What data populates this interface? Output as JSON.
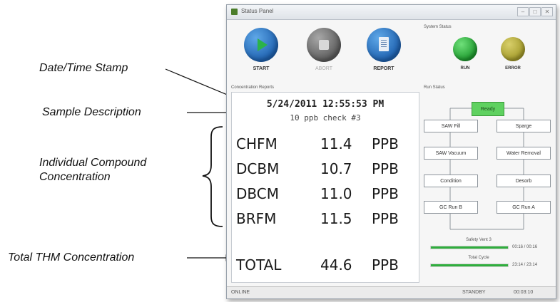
{
  "annotations": {
    "datetime": "Date/Time Stamp",
    "sample": "Sample Description",
    "compound": "Individual Compound Concentration",
    "total": "Total THM Concentration"
  },
  "window": {
    "title": "Status Panel",
    "controls": [
      "–",
      "□",
      "✕"
    ]
  },
  "actions": {
    "start": "START",
    "abort": "ABORT",
    "report": "REPORT"
  },
  "concentration_reports": {
    "label": "Concentration Reports",
    "datetime": "5/24/2011 12:55:53 PM",
    "sample": "10 ppb check #3",
    "compounds": [
      {
        "name": "CHFM",
        "value": "11.4",
        "unit": "PPB"
      },
      {
        "name": "DCBM",
        "value": "10.7",
        "unit": "PPB"
      },
      {
        "name": "DBCM",
        "value": "11.0",
        "unit": "PPB"
      },
      {
        "name": "BRFM",
        "value": "11.5",
        "unit": "PPB"
      }
    ],
    "total": {
      "name": "TOTAL",
      "value": "44.6",
      "unit": "PPB"
    }
  },
  "system_status": {
    "label": "System Status",
    "run": {
      "label": "RUN",
      "color": "#1e9a2e"
    },
    "error": {
      "label": "ERROR",
      "color": "#a39a2a"
    }
  },
  "run_status": {
    "label": "Run Status",
    "ready": "Ready",
    "steps_left": [
      "SAW Fill",
      "SAW Vacuum",
      "Condition",
      "GC Run B"
    ],
    "steps_right": [
      "Sparge",
      "Water Removal",
      "Desorb",
      "GC Run A"
    ]
  },
  "progress": {
    "safety_vent": {
      "label": "Safety Vent 3",
      "time": "00:16 / 00:16",
      "fraction": 1.0
    },
    "total_cycle": {
      "label": "Total Cycle",
      "time": "23:14 / 23:14",
      "fraction": 1.0
    }
  },
  "statusbar": {
    "left": "ONLINE",
    "mid": "STANDBY",
    "right": "00:03:10"
  }
}
